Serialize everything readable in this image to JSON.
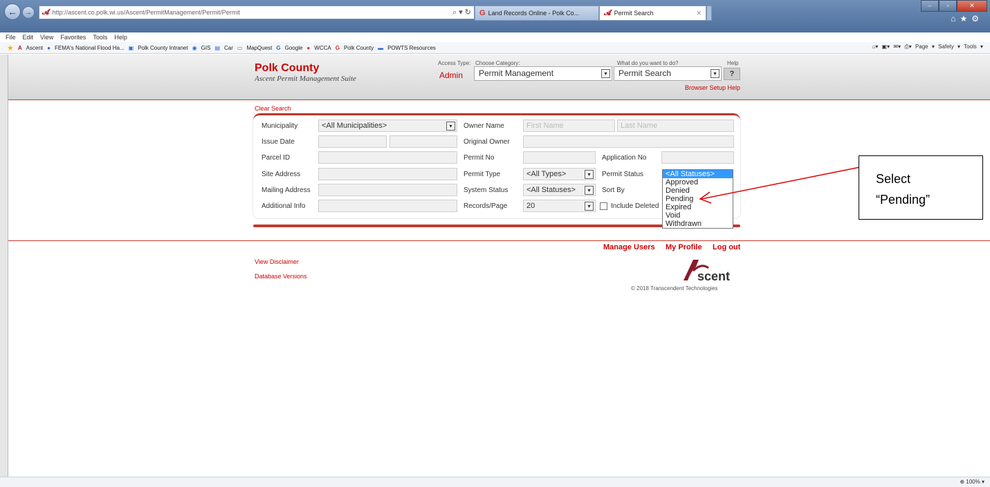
{
  "browser": {
    "url": "http://ascent.co.polk.wi.us/Ascent/PermitManagement/Permit/Permit",
    "tabs": [
      {
        "label": "Land Records Online - Polk Co..."
      },
      {
        "label": "Permit Search"
      }
    ],
    "menu": [
      "File",
      "Edit",
      "View",
      "Favorites",
      "Tools",
      "Help"
    ],
    "favorites": [
      "Ascent",
      "FEMA's National Flood Ha...",
      "Polk County Intranet",
      "GIS",
      "Car",
      "MapQuest",
      "Google",
      "WCCA",
      "Polk County",
      "POWTS Resources"
    ],
    "right_tools": "Page ▾  Safety ▾  Tools ▾",
    "zoom": "100%"
  },
  "header": {
    "brand": "Polk County",
    "suite": "Ascent Permit Management Suite",
    "access_type_label": "Access Type:",
    "access_type_value": "Admin",
    "category_label": "Choose Category:",
    "category_value": "Permit Management",
    "action_label": "What do you want to do?",
    "action_value": "Permit Search",
    "help_label": "Help",
    "help_button": "?",
    "browser_setup_help": "Browser Setup Help"
  },
  "search": {
    "clear_search": "Clear Search",
    "fields": {
      "municipality": {
        "label": "Municipality",
        "value": "<All Municipalities>"
      },
      "owner_name": {
        "label": "Owner Name",
        "first_placeholder": "First Name",
        "last_placeholder": "Last Name"
      },
      "issue_date": {
        "label": "Issue Date"
      },
      "original_owner": {
        "label": "Original Owner"
      },
      "parcel_id": {
        "label": "Parcel ID"
      },
      "permit_no": {
        "label": "Permit No"
      },
      "application_no": {
        "label": "Application No"
      },
      "site_address": {
        "label": "Site Address"
      },
      "permit_type": {
        "label": "Permit Type",
        "value": "<All Types>"
      },
      "permit_status": {
        "label": "Permit Status"
      },
      "mailing_address": {
        "label": "Mailing Address"
      },
      "system_status": {
        "label": "System Status",
        "value": "<All Statuses>"
      },
      "sort_by": {
        "label": "Sort By"
      },
      "additional_info": {
        "label": "Additional Info"
      },
      "records_page": {
        "label": "Records/Page",
        "value": "20"
      },
      "include_deleted": {
        "label": "Include Deleted"
      }
    },
    "status_options": [
      "<All Statuses>",
      "Approved",
      "Denied",
      "Pending",
      "Expired",
      "Void",
      "Withdrawn"
    ],
    "status_selected_index": 0
  },
  "annotation": {
    "line1": "Select",
    "line2": "“Pending”",
    "color": "#e00000"
  },
  "footer": {
    "manage_users": "Manage Users",
    "my_profile": "My Profile",
    "log_out": "Log out",
    "view_disclaimer": "View Disclaimer",
    "database_versions": "Database Versions",
    "logo_text": "scent",
    "copyright": "© 2018 Transcendent Technologies"
  },
  "colors": {
    "brand_red": "#c00000",
    "accent_red": "#c0392b",
    "selection_blue": "#3399ff"
  }
}
